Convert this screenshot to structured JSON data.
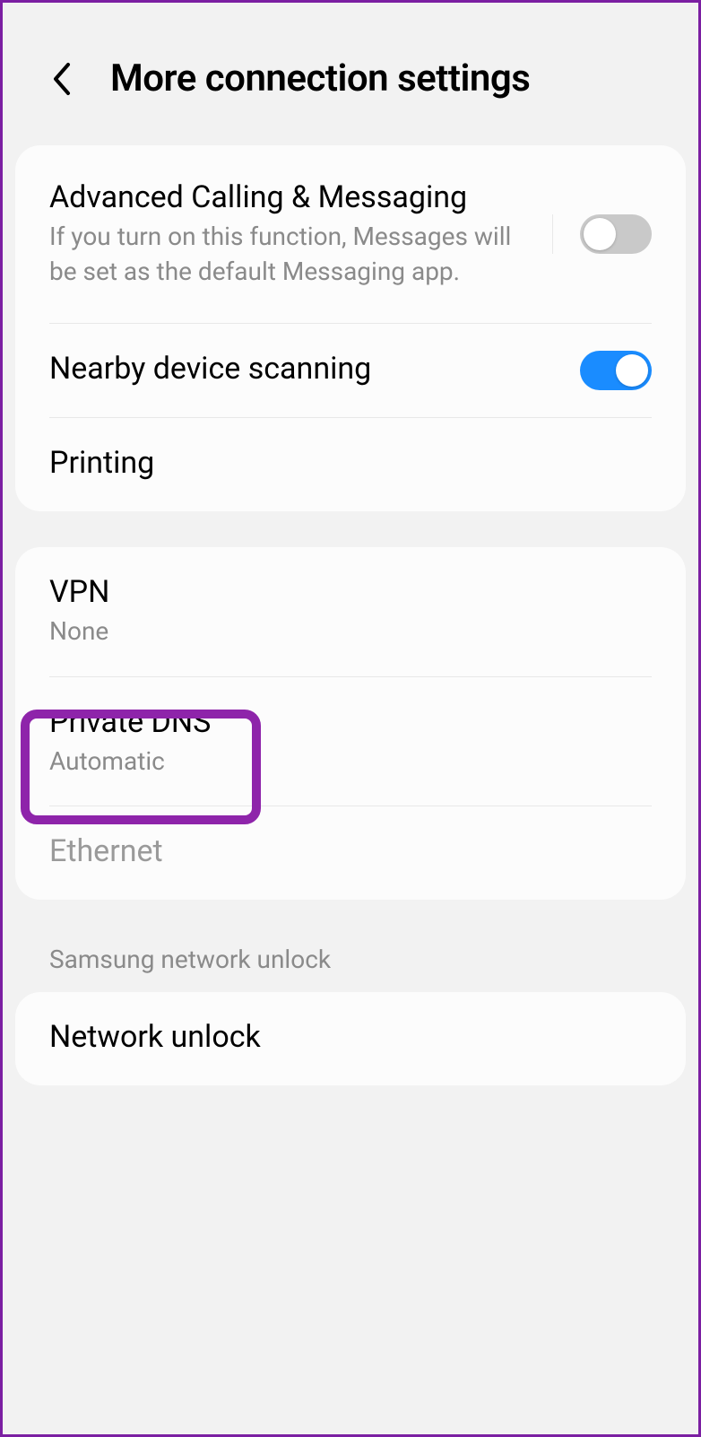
{
  "header": {
    "title": "More connection settings"
  },
  "groups": [
    {
      "items": [
        {
          "title": "Advanced Calling & Messaging",
          "subtitle": "If you turn on this function, Messages will be set as the default Messaging app.",
          "toggle": {
            "state": "off"
          },
          "toggleDivider": true
        },
        {
          "title": "Nearby device scanning",
          "toggle": {
            "state": "on"
          },
          "toggleDivider": false
        },
        {
          "title": "Printing"
        }
      ]
    },
    {
      "items": [
        {
          "title": "VPN",
          "subtitle": "None"
        },
        {
          "title": "Private DNS",
          "subtitle": "Automatic",
          "highlighted": true
        },
        {
          "title": "Ethernet",
          "disabled": true
        }
      ]
    }
  ],
  "section": {
    "title": "Samsung network unlock"
  },
  "groups2": [
    {
      "items": [
        {
          "title": "Network unlock"
        }
      ]
    }
  ]
}
